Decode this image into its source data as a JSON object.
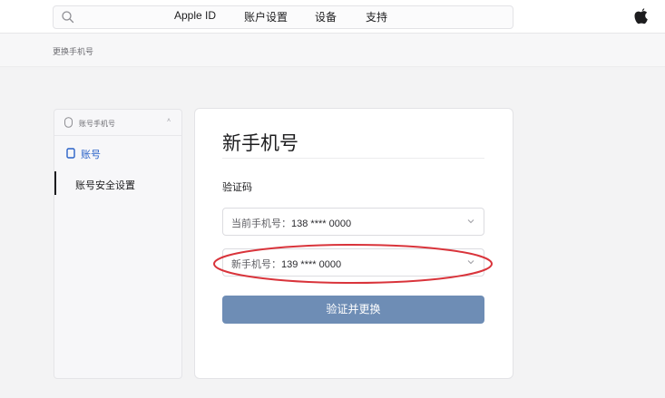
{
  "nav": {
    "links": [
      "Apple ID",
      "账户设置",
      "设备",
      "支持"
    ]
  },
  "breadcrumb": "更换手机号",
  "sidebar": {
    "header_label": "账号手机号",
    "header_chevron": "˄",
    "section_label": "账号",
    "items": [
      {
        "label": "账号安全设置",
        "active": true
      }
    ]
  },
  "card": {
    "title": "新手机号",
    "code_label": "验证码",
    "fields": [
      {
        "label": "当前手机号：",
        "value": "138 **** 0000"
      },
      {
        "label": "新手机号：",
        "value": "139 **** 0000"
      }
    ],
    "submit_label": "验证并更换"
  },
  "colors": {
    "accent": "#6e8db5",
    "link": "#2a62c8",
    "highlight": "#d9343b"
  }
}
